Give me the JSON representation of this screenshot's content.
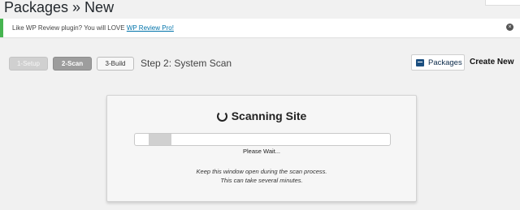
{
  "page": {
    "title": "Packages » New"
  },
  "notice": {
    "text": "Like WP Review plugin? You will LOVE ",
    "link_text": "WP Review Pro!",
    "dismiss_icon": "close-circle-icon"
  },
  "steps": {
    "items": [
      {
        "label": "1-Setup",
        "state": "completed"
      },
      {
        "label": "2-Scan",
        "state": "active"
      },
      {
        "label": "3-Build",
        "state": "upcoming"
      }
    ],
    "title": "Step 2: System Scan"
  },
  "header_actions": {
    "packages_label": "Packages",
    "packages_icon": "package-icon",
    "create_new_label": "Create New"
  },
  "scan": {
    "title": "Scanning Site",
    "spinner_icon": "spinner-icon",
    "progress_fraction": 0.09,
    "status_text": "Please Wait...",
    "note_line1": "Keep this window open during the scan process.",
    "note_line2": "This can take several minutes."
  },
  "colors": {
    "background": "#f1f1f1",
    "notice_accent": "#46b450",
    "link": "#0073aa",
    "active_step": "#9d9d9d"
  }
}
